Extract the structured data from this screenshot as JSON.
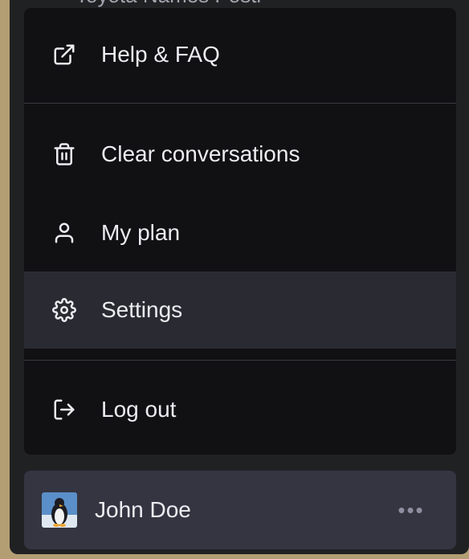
{
  "menu": {
    "peek_text": "Toyota Names Posti",
    "items": [
      {
        "label": "Help & FAQ",
        "icon": "external-link-icon"
      },
      {
        "label": "Clear conversations",
        "icon": "trash-icon"
      },
      {
        "label": "My plan",
        "icon": "user-icon"
      },
      {
        "label": "Settings",
        "icon": "gear-icon",
        "active": true
      },
      {
        "label": "Log out",
        "icon": "logout-icon"
      }
    ]
  },
  "user": {
    "name": "John Doe",
    "more_label": "•••",
    "avatar_icon": "penguin-avatar-icon"
  },
  "colors": {
    "menu_bg": "#111113",
    "active_bg": "#2a2b32",
    "user_bg": "#343541",
    "text": "#ececf1"
  }
}
